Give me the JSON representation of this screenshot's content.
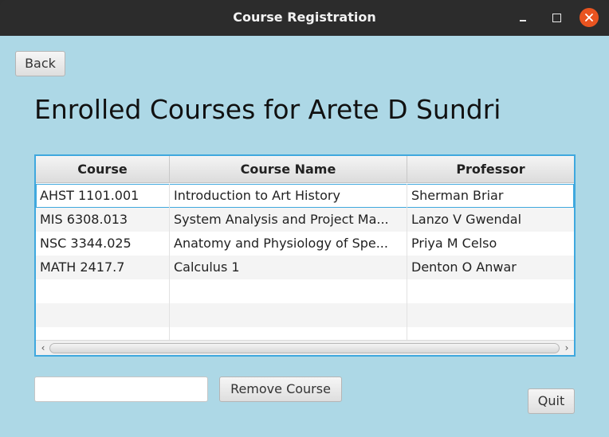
{
  "window": {
    "title": "Course Registration"
  },
  "toolbar": {
    "back_label": "Back"
  },
  "page": {
    "heading": "Enrolled Courses for Arete D Sundri"
  },
  "table": {
    "columns": [
      "Course",
      "Course Name",
      "Professor"
    ],
    "rows": [
      [
        "AHST 1101.001",
        "Introduction to Art History",
        "Sherman Briar"
      ],
      [
        "MIS 6308.013",
        "System Analysis and Project Ma...",
        "Lanzo V Gwendal"
      ],
      [
        "NSC 3344.025",
        "Anatomy and Physiology of Spe...",
        "Priya M Celso"
      ],
      [
        "MATH 2417.7",
        "Calculus 1",
        "Denton O Anwar"
      ]
    ],
    "selected_row": 0
  },
  "actions": {
    "course_input_value": "",
    "remove_label": "Remove Course",
    "quit_label": "Quit"
  },
  "colors": {
    "background": "#add8e6",
    "focus": "#3fa8de",
    "close_button": "#e95420"
  }
}
